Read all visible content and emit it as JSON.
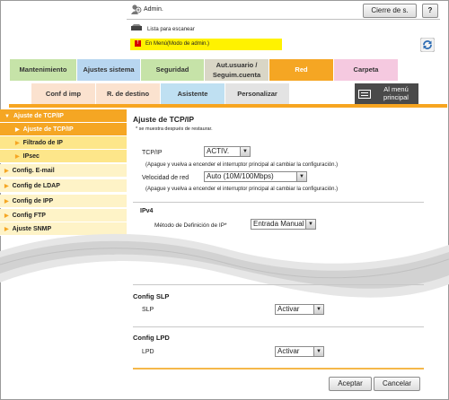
{
  "header": {
    "admin_label": "Admin.",
    "logout_button": "Cierre de s.",
    "help_button": "?",
    "scan_list": "Lista para escanear",
    "mode_text": "En Menú(Modo de admin.)"
  },
  "tabs_top": [
    {
      "label": "Mantenimiento",
      "bg": "#c6e3a8"
    },
    {
      "label": "Ajustes sistema",
      "bg": "#b8d6f0"
    },
    {
      "label": "Seguridad",
      "bg": "#c6e3a8"
    },
    {
      "label_line1": "Aut.usuario /",
      "label_line2": "Seguim.cuenta",
      "bg": "#d9d6c6"
    },
    {
      "label": "Red",
      "bg": "#f5a623",
      "active": true
    },
    {
      "label": "Carpeta",
      "bg": "#f5c9e0"
    }
  ],
  "tabs_bottom": [
    {
      "label": "Conf d imp",
      "bg": "#fbe2cf"
    },
    {
      "label": "R. de destino",
      "bg": "#fbe2cf"
    },
    {
      "label": "Asistente",
      "bg": "#bfe0f2"
    },
    {
      "label": "Personalizar",
      "bg": "#e3e3e3"
    },
    {
      "label_line1": "Al menú",
      "label_line2": "principal",
      "bg": "#4a4a4a"
    }
  ],
  "sidebar": [
    {
      "label": "Ajuste de TCP/IP",
      "level": 0,
      "expanded": true,
      "bg": "#f5a623",
      "color": "#ffffff"
    },
    {
      "label": "Ajuste de TCP/IP",
      "level": 1,
      "selected": true,
      "bg": "#f5a623",
      "color": "#ffffff"
    },
    {
      "label": "Filtrado de IP",
      "level": 1,
      "bg": "#fde68a",
      "color": "#222222"
    },
    {
      "label": "IPsec",
      "level": 1,
      "bg": "#fde68a",
      "color": "#222222"
    },
    {
      "label": "Config. E-mail",
      "level": 0,
      "bg": "#fef3c7",
      "color": "#222222"
    },
    {
      "label": "Config de LDAP",
      "level": 0,
      "bg": "#fef3c7",
      "color": "#222222"
    },
    {
      "label": "Config de IPP",
      "level": 0,
      "bg": "#fef3c7",
      "color": "#222222"
    },
    {
      "label": "Config FTP",
      "level": 0,
      "bg": "#fef3c7",
      "color": "#222222"
    },
    {
      "label": "Ajuste SNMP",
      "level": 0,
      "bg": "#fef3c7",
      "color": "#222222"
    }
  ],
  "main": {
    "title": "Ajuste de TCP/IP",
    "note": "* se muestra después de restaurar.",
    "tcpip_label": "TCP/IP",
    "tcpip_value": "ACTIV.",
    "tcpip_note": "(Apague y vuelva a encender el interruptor principal al cambiar la configuración.)",
    "speed_label": "Velocidad de red",
    "speed_value": "Auto (10M/100Mbps)",
    "speed_note": "(Apague y vuelva a encender el interruptor principal al cambiar la configuración.)",
    "ipv4_header": "IPv4",
    "ip_method_label": "Método de Definición de IP*",
    "ip_method_value": "Entrada Manual",
    "slp_header": "Config SLP",
    "slp_label": "SLP",
    "slp_value": "Activar",
    "lpd_header": "Config LPD",
    "lpd_label": "LPD",
    "lpd_value": "Activar",
    "accept_button": "Aceptar",
    "cancel_button": "Cancelar"
  },
  "colors": {
    "accent": "#f5a623",
    "mode_bar": "#fff200"
  }
}
